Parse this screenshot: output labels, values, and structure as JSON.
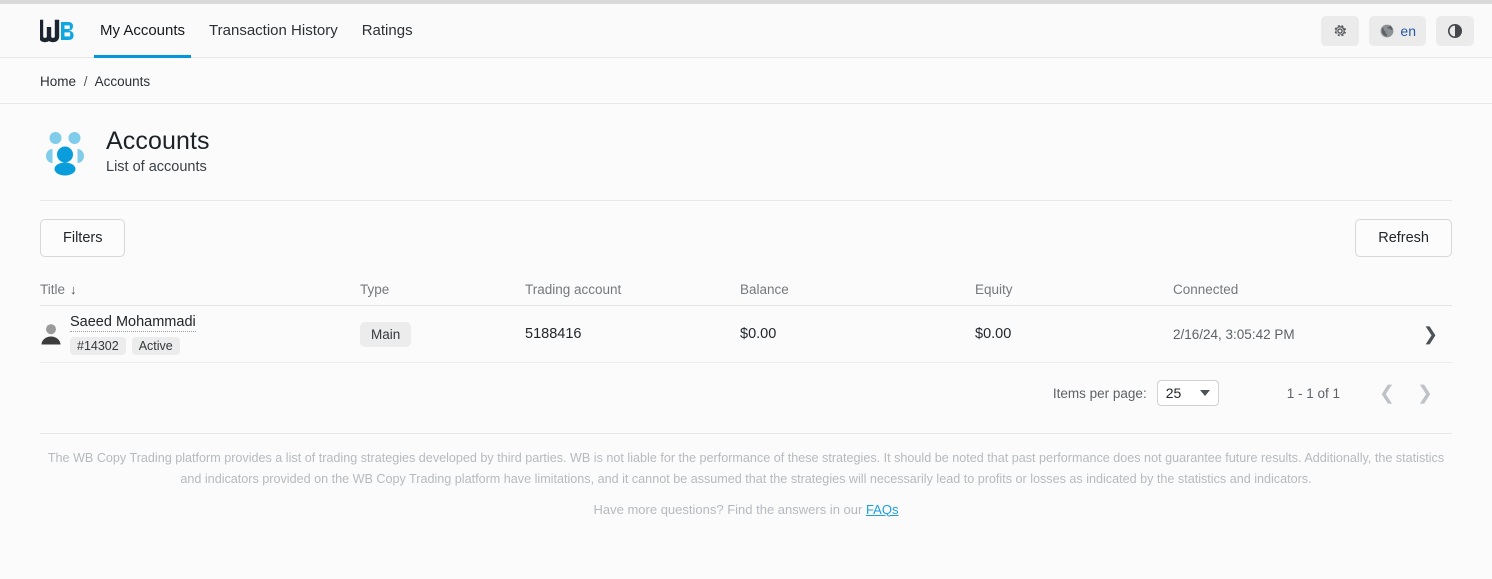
{
  "header": {
    "logo_text": "WB",
    "nav": [
      {
        "label": "My Accounts",
        "active": true
      },
      {
        "label": "Transaction History",
        "active": false
      },
      {
        "label": "Ratings",
        "active": false
      }
    ],
    "actions": {
      "settings_icon": "gear-icon",
      "language_icon": "globe-icon",
      "language_label": "en",
      "theme_icon": "contrast-icon"
    }
  },
  "breadcrumb": {
    "home": "Home",
    "separator": "/",
    "current": "Accounts"
  },
  "page": {
    "icon": "accounts-group-icon",
    "title": "Accounts",
    "subtitle": "List of accounts"
  },
  "toolbar": {
    "filters_label": "Filters",
    "refresh_label": "Refresh"
  },
  "table": {
    "columns": [
      {
        "key": "title",
        "label": "Title",
        "sorted": true,
        "sort_icon": "arrow-down-icon"
      },
      {
        "key": "type",
        "label": "Type"
      },
      {
        "key": "trading_account",
        "label": "Trading account"
      },
      {
        "key": "balance",
        "label": "Balance"
      },
      {
        "key": "equity",
        "label": "Equity"
      },
      {
        "key": "connected",
        "label": "Connected"
      }
    ],
    "rows": [
      {
        "avatar_icon": "person-icon",
        "name": "Saeed Mohammadi",
        "id_badge": "#14302",
        "status_badge": "Active",
        "type": "Main",
        "trading_account": "5188416",
        "balance": "$0.00",
        "equity": "$0.00",
        "connected": "2/16/24, 3:05:42 PM",
        "row_chevron": "chevron-right-icon"
      }
    ]
  },
  "paginator": {
    "items_per_page_label": "Items per page:",
    "items_per_page_value": "25",
    "range_label": "1 - 1 of 1",
    "prev_icon": "chevron-left-icon",
    "next_icon": "chevron-right-icon"
  },
  "footer": {
    "disclaimer": "The WB Copy Trading platform provides a list of trading strategies developed by third parties. WB is not liable for the performance of these strategies. It should be noted that past performance does not guarantee future results. Additionally, the statistics and indicators provided on the WB Copy Trading platform have limitations, and it cannot be assumed that the strategies will necessarily lead to profits or losses as indicated by the statistics and indicators.",
    "faq_text": "Have more questions? Find the answers in our",
    "faq_link": "FAQs"
  },
  "colors": {
    "accent": "#0098da",
    "logo_dark": "#1b2430",
    "link": "#1e9fe0",
    "badge_bg": "#ececec",
    "icon_light_blue": "#7fcdea",
    "icon_blue": "#0a9ddb"
  }
}
